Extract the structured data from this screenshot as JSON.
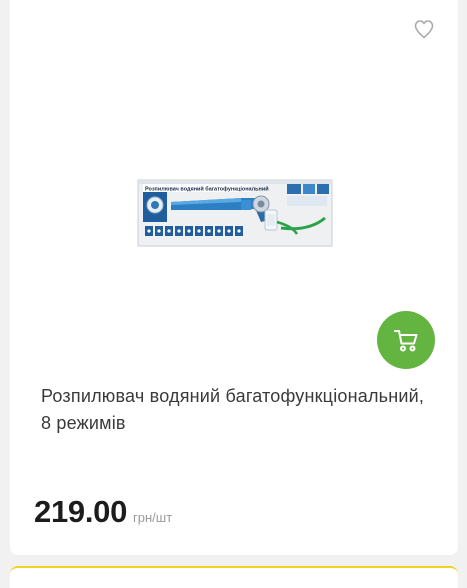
{
  "product": {
    "title": "Розпилювач водяний багатофункціональний, 8 режимів",
    "price": "219.00",
    "unit": "грн/шт",
    "image_alt": "Розпилювач водяний багатофункціональний",
    "image_label": "Розпилювач водяний багатофункціональний"
  },
  "icons": {
    "wishlist": "heart-icon",
    "cart": "cart-icon"
  },
  "colors": {
    "accent": "#64b441",
    "price_text": "#1c1c1c",
    "unit_text": "#9a9a9a",
    "next_card_border": "#f1d21e"
  }
}
